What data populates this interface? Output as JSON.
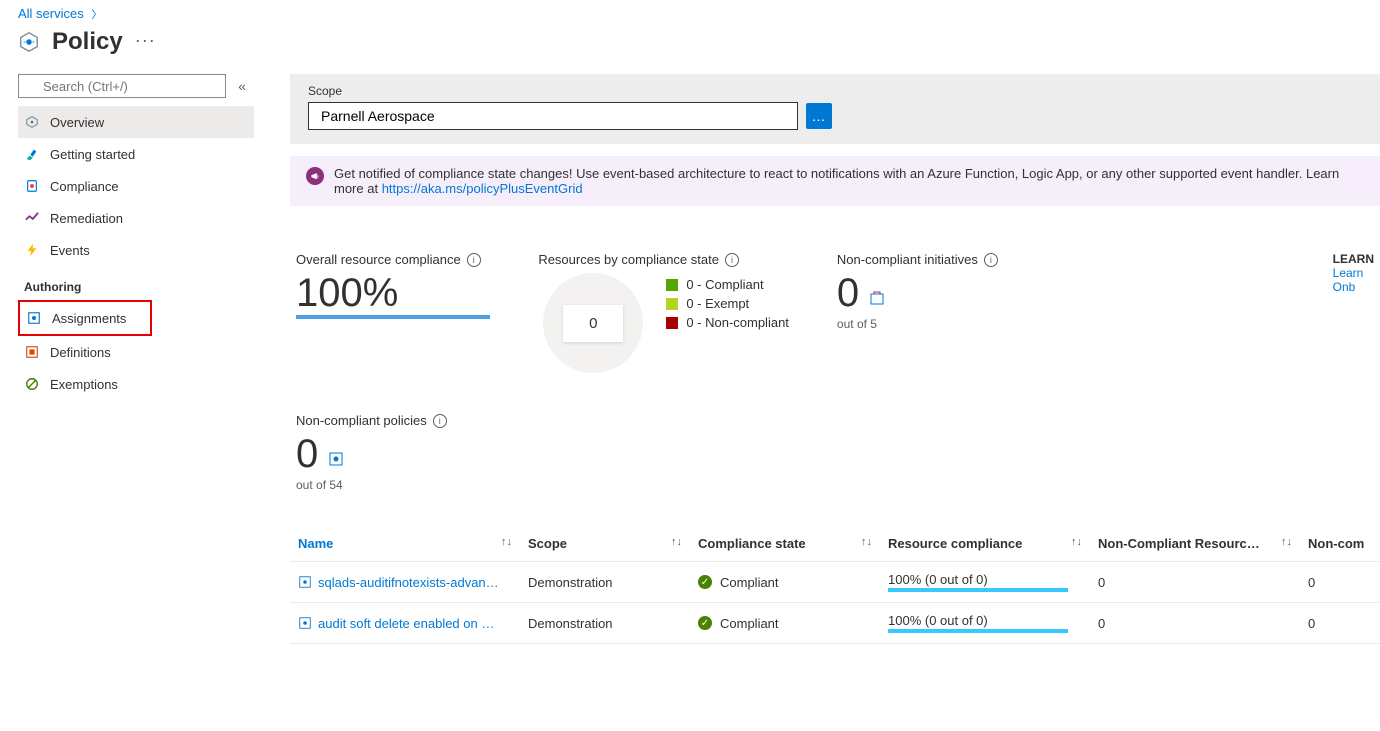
{
  "breadcrumb": {
    "all_services": "All services"
  },
  "page": {
    "title": "Policy",
    "more_aria": "More"
  },
  "search": {
    "placeholder": "Search (Ctrl+/)"
  },
  "nav": {
    "items": [
      {
        "label": "Overview"
      },
      {
        "label": "Getting started"
      },
      {
        "label": "Compliance"
      },
      {
        "label": "Remediation"
      },
      {
        "label": "Events"
      }
    ],
    "authoring_heading": "Authoring",
    "authoring": [
      {
        "label": "Assignments"
      },
      {
        "label": "Definitions"
      },
      {
        "label": "Exemptions"
      }
    ]
  },
  "scope": {
    "label": "Scope",
    "value": "Parnell Aerospace"
  },
  "notif": {
    "text": "Get notified of compliance state changes! Use event-based architecture to react to notifications with an Azure Function, Logic App, or any other supported event handler. Learn more at",
    "link": "https://aka.ms/policyPlusEventGrid"
  },
  "overall": {
    "title": "Overall resource compliance",
    "value": "100%"
  },
  "bystate": {
    "title": "Resources by compliance state",
    "count": "0",
    "legend": [
      {
        "text": "0 - Compliant"
      },
      {
        "text": "0 - Exempt"
      },
      {
        "text": "0 - Non-compliant"
      }
    ]
  },
  "nc_init": {
    "title": "Non-compliant initiatives",
    "value": "0",
    "sub": "out of 5"
  },
  "learn": {
    "heading": "LEARN",
    "l1": "Learn",
    "l2": "Onb"
  },
  "nc_pol": {
    "title": "Non-compliant policies",
    "value": "0",
    "sub": "out of 54"
  },
  "table": {
    "headers": {
      "name": "Name",
      "scope": "Scope",
      "state": "Compliance state",
      "rc": "Resource compliance",
      "ncr": "Non-Compliant Resourc…",
      "nc": "Non-com"
    },
    "rows": [
      {
        "name": "sqlads-auditifnotexists-advan…",
        "scope": "Demonstration",
        "state": "Compliant",
        "rc": "100% (0 out of 0)",
        "ncr": "0",
        "nc": "0"
      },
      {
        "name": "audit soft delete enabled on …",
        "scope": "Demonstration",
        "state": "Compliant",
        "rc": "100% (0 out of 0)",
        "ncr": "0",
        "nc": "0"
      }
    ]
  }
}
